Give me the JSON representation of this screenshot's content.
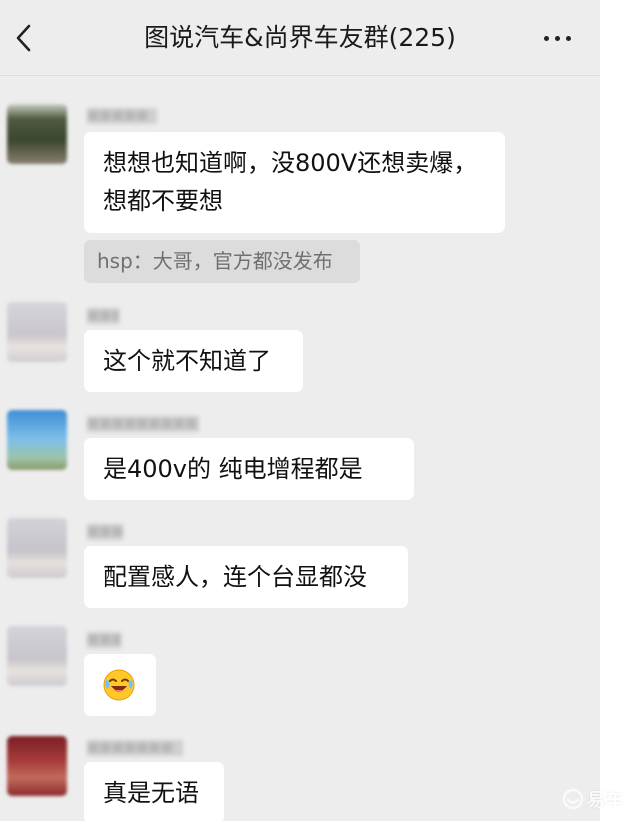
{
  "header": {
    "title": "图说汽车&尚界车友群(225)"
  },
  "icons": {
    "back": "chevron-left-icon",
    "more": "more-dots-icon",
    "emoji": "laughing-crying-emoji-icon",
    "watermark": "yiche-logo-icon"
  },
  "messages": [
    {
      "name": "■■■■■",
      "text_line1": "想想也知道啊，没800V还想卖爆，",
      "text_line2": "想都不要想",
      "quote": "hsp：大哥，官方都没发布"
    },
    {
      "name": "■■■",
      "text": "这个就不知道了"
    },
    {
      "name": "■■■■■■■■■",
      "text": "是400v的  纯电增程都是"
    },
    {
      "name": "■■■",
      "text": "配置感人，连个台显都没"
    },
    {
      "name": "■■■",
      "emoji": "😂"
    },
    {
      "name": "■■■■■■■",
      "text": "真是无语"
    }
  ],
  "watermark": {
    "text": "易车"
  },
  "colors": {
    "background": "#ededed",
    "bubble": "#ffffff",
    "quote_background": "#dcdcdc",
    "quote_text": "#707070"
  }
}
